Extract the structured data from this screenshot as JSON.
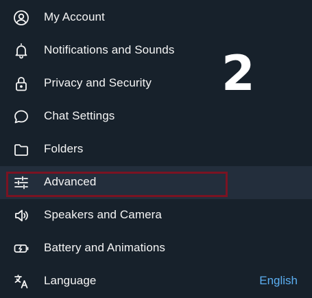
{
  "menu": {
    "items": [
      {
        "label": "My Account",
        "icon": "account-icon"
      },
      {
        "label": "Notifications and Sounds",
        "icon": "bell-icon"
      },
      {
        "label": "Privacy and Security",
        "icon": "lock-icon"
      },
      {
        "label": "Chat Settings",
        "icon": "chat-bubble-icon"
      },
      {
        "label": "Folders",
        "icon": "folder-icon"
      },
      {
        "label": "Advanced",
        "icon": "sliders-icon",
        "selected": true
      },
      {
        "label": "Speakers and Camera",
        "icon": "speaker-icon"
      },
      {
        "label": "Battery and Animations",
        "icon": "battery-icon"
      },
      {
        "label": "Language",
        "icon": "translate-icon",
        "value": "English"
      }
    ]
  },
  "annotation": {
    "step_number": "2",
    "highlight_color": "#7b1322"
  },
  "colors": {
    "background": "#17212b",
    "selected_background": "#232e3c",
    "text": "#f5f5f5",
    "accent": "#5caff2"
  }
}
